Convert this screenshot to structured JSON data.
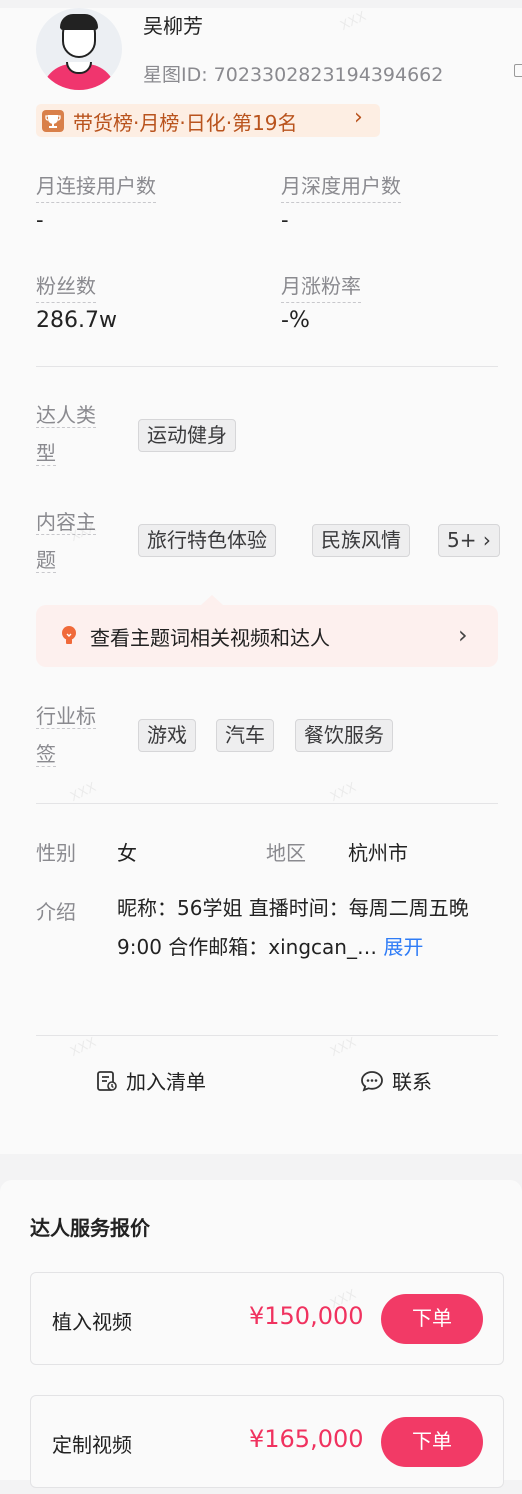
{
  "profile": {
    "name": "吴柳芳",
    "star_id": "星图ID: 7023302823194394662",
    "rank_text": "带货榜·月榜·日化·第19名",
    "rank_chevron": "›"
  },
  "metrics": [
    {
      "label": "月连接用户数",
      "value": "-"
    },
    {
      "label": "月深度用户数",
      "value": "-"
    },
    {
      "label": "粉丝数",
      "value": "286.7w"
    },
    {
      "label": "月涨粉率",
      "value": "-%"
    }
  ],
  "talent_type": {
    "label_line1": "达人类",
    "label_line2": "型",
    "tags": [
      "运动健身"
    ]
  },
  "content_topic": {
    "label_line1": "内容主",
    "label_line2": "题",
    "tags": [
      "旅行特色体验",
      "民族风情"
    ],
    "more": "5+ ›"
  },
  "tip": {
    "text": "查看主题词相关视频和达人",
    "arrow": "›"
  },
  "industry": {
    "label_line1": "行业标",
    "label_line2": "签",
    "tags": [
      "游戏",
      "汽车",
      "餐饮服务"
    ]
  },
  "info": {
    "gender_label": "性别",
    "gender": "女",
    "region_label": "地区",
    "region": "杭州市",
    "intro_label": "介绍",
    "intro_text": "昵称：56学姐 直播时间：每周二周五晚9:00 合作邮箱：xingcan_…",
    "expand": "展开"
  },
  "actions": {
    "add_list": "加入清单",
    "contact": "联系"
  },
  "pricing": {
    "title": "达人服务报价",
    "items": [
      {
        "label": "植入视频",
        "price": "¥150,000",
        "button": "下单"
      },
      {
        "label": "定制视频",
        "price": "¥165,000",
        "button": "下单"
      }
    ]
  },
  "watermark": "XXX",
  "colors": {
    "accent": "#f23a66",
    "price": "#f0325f",
    "link": "#2f7cf6",
    "rank_bg": "#fdeee3",
    "rank_text": "#b9531d"
  }
}
